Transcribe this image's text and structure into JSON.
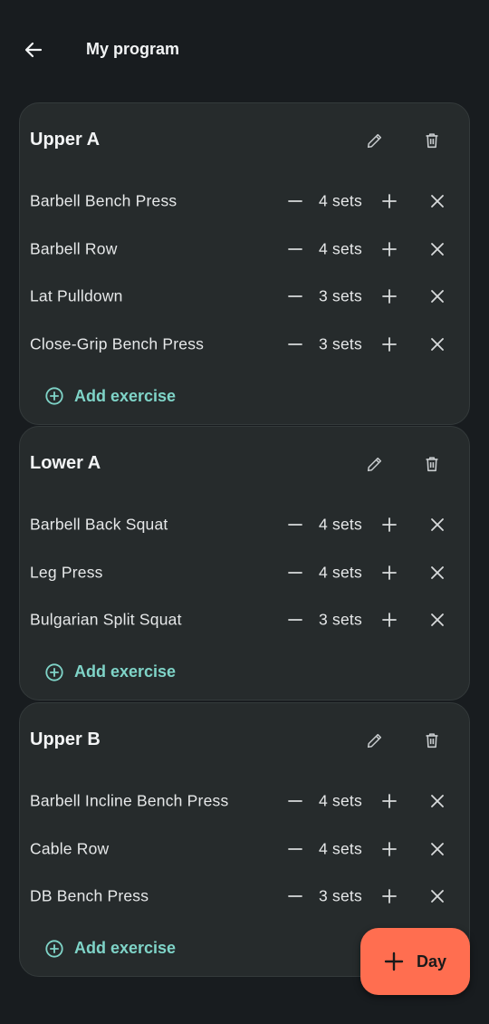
{
  "header": {
    "title": "My program"
  },
  "days": [
    {
      "name": "Upper A",
      "exercises": [
        {
          "name": "Barbell Bench Press",
          "sets": "4 sets"
        },
        {
          "name": "Barbell Row",
          "sets": "4 sets"
        },
        {
          "name": "Lat Pulldown",
          "sets": "3 sets"
        },
        {
          "name": "Close-Grip Bench Press",
          "sets": "3 sets"
        }
      ],
      "add_label": "Add exercise"
    },
    {
      "name": "Lower A",
      "exercises": [
        {
          "name": "Barbell Back Squat",
          "sets": "4 sets"
        },
        {
          "name": "Leg Press",
          "sets": "4 sets"
        },
        {
          "name": "Bulgarian Split Squat",
          "sets": "3 sets"
        }
      ],
      "add_label": "Add exercise"
    },
    {
      "name": "Upper B",
      "exercises": [
        {
          "name": "Barbell Incline Bench Press",
          "sets": "4 sets"
        },
        {
          "name": "Cable Row",
          "sets": "4 sets"
        },
        {
          "name": "DB Bench Press",
          "sets": "3 sets"
        }
      ],
      "add_label": "Add exercise"
    }
  ],
  "fab": {
    "label": "Day",
    "icon": "plus-icon"
  },
  "colors": {
    "background": "#181c1f",
    "card": "#262b2c",
    "accent_teal": "#7fd4c8",
    "fab": "#ff6e50",
    "text": "#e4e6e7"
  }
}
